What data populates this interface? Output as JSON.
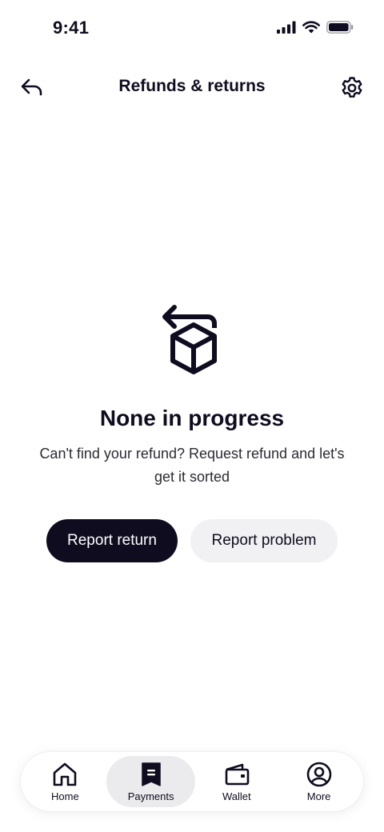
{
  "status_bar": {
    "time": "9:41"
  },
  "header": {
    "title": "Refunds & returns",
    "back_icon": "back-arrow-icon",
    "settings_icon": "gear-icon"
  },
  "empty_state": {
    "icon": "box-return-icon",
    "title": "None in progress",
    "description": "Can't find your refund? Request refund and let's get it sorted"
  },
  "actions": {
    "primary_label": "Report return",
    "secondary_label": "Report problem"
  },
  "bottom_nav": {
    "items": [
      {
        "label": "Home",
        "icon": "home-icon",
        "active": false
      },
      {
        "label": "Payments",
        "icon": "receipt-icon",
        "active": true
      },
      {
        "label": "Wallet",
        "icon": "wallet-icon",
        "active": false
      },
      {
        "label": "More",
        "icon": "profile-icon",
        "active": false
      }
    ]
  },
  "colors": {
    "primary": "#0f0c1f",
    "secondary_bg": "#f1f1f3",
    "active_nav_bg": "#ebebee",
    "background": "#ffffff"
  }
}
